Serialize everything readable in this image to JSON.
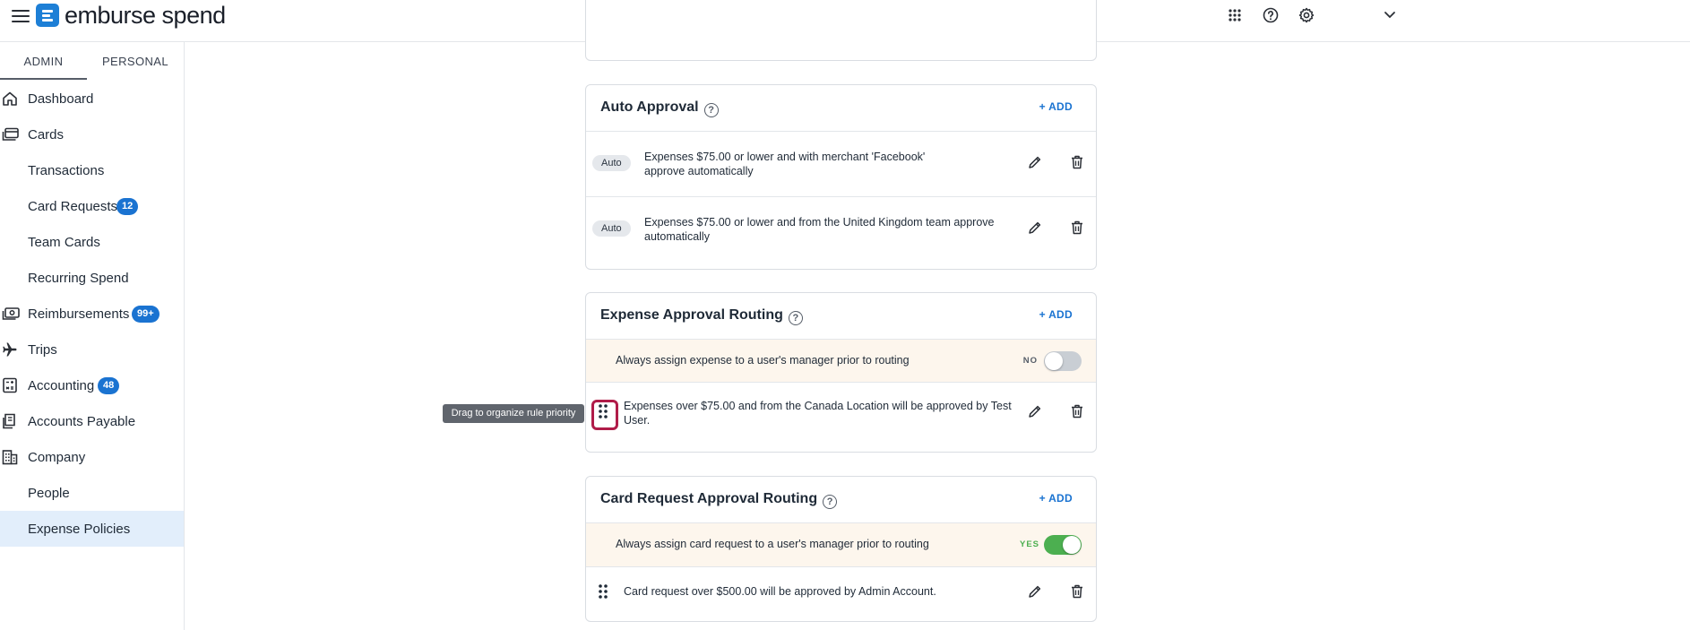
{
  "app": {
    "brand": "emburse spend"
  },
  "sidebar": {
    "tabs": [
      {
        "label": "ADMIN",
        "active": true
      },
      {
        "label": "PERSONAL",
        "active": false
      }
    ],
    "items": [
      {
        "label": "Dashboard",
        "icon": "home-icon"
      },
      {
        "label": "Cards",
        "icon": "cards-icon"
      },
      {
        "label": "Transactions"
      },
      {
        "label": "Card Requests",
        "badge": "12"
      },
      {
        "label": "Team Cards"
      },
      {
        "label": "Recurring Spend"
      },
      {
        "label": "Reimbursements",
        "icon": "money-icon",
        "badge": "99+"
      },
      {
        "label": "Trips",
        "icon": "plane-icon"
      },
      {
        "label": "Accounting",
        "icon": "calculator-icon",
        "badge": "48"
      },
      {
        "label": "Accounts Payable",
        "icon": "invoice-icon"
      },
      {
        "label": "Company",
        "icon": "building-icon"
      },
      {
        "label": "People"
      },
      {
        "label": "Expense Policies",
        "active": true
      }
    ]
  },
  "auto_approval": {
    "title": "Auto Approval",
    "add_label": "+ ADD",
    "rules": [
      {
        "pill": "Auto",
        "text": "Expenses $75.00 or lower and with merchant 'Facebook' approve automatically"
      },
      {
        "pill": "Auto",
        "text": "Expenses $75.00 or lower and from the United Kingdom team approve automatically"
      }
    ]
  },
  "expense_routing": {
    "title": "Expense Approval Routing",
    "add_label": "+ ADD",
    "toggle_label": "Always assign expense to a user's manager prior to routing",
    "toggle_state": "NO",
    "rules": [
      {
        "text": "Expenses over $75.00 and from the Canada Location will be approved by Test User."
      }
    ]
  },
  "card_request_routing": {
    "title": "Card Request Approval Routing",
    "add_label": "+ ADD",
    "toggle_label": "Always assign card request to a user's manager prior to routing",
    "toggle_state": "YES",
    "rules": [
      {
        "text": "Card request over $500.00 will be approved by Admin Account."
      }
    ]
  },
  "tooltip": {
    "text": "Drag to organize rule priority"
  },
  "colors": {
    "accent": "#1a73d1",
    "toggle_on": "#4caf50",
    "toggle_off": "#c9ced4",
    "highlight_row": "#fdf6ed",
    "focus": "#b01c49"
  }
}
